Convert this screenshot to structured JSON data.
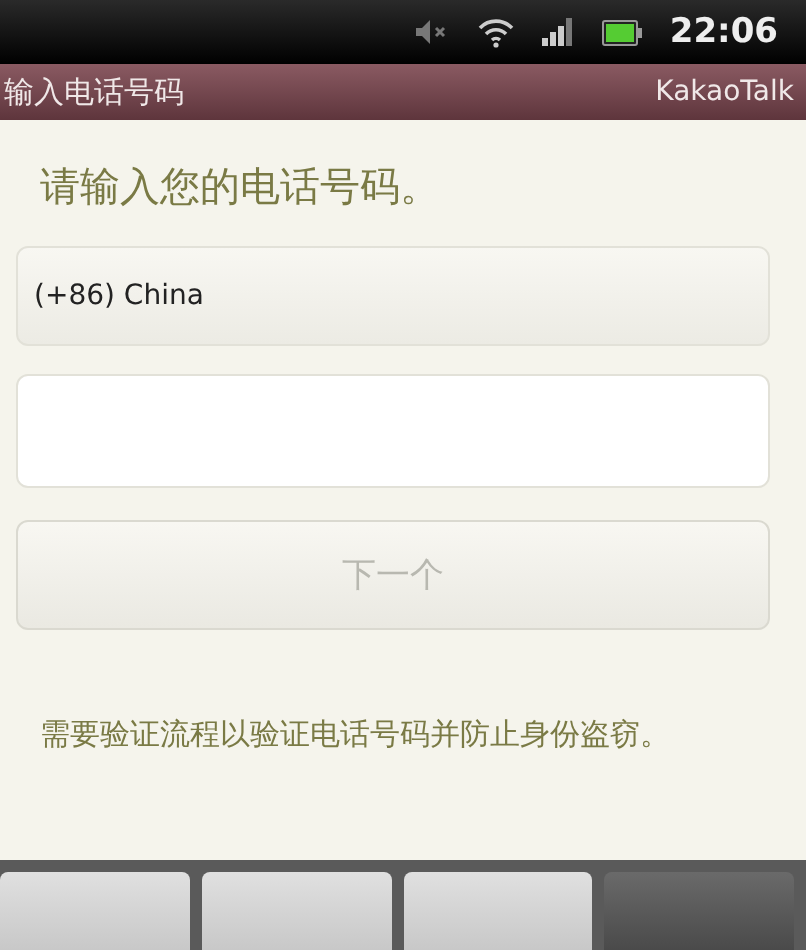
{
  "status_bar": {
    "time": "22:06"
  },
  "title_bar": {
    "title": "输入电话号码",
    "app_name": "KakaoTalk"
  },
  "heading": "请输入您的电话号码。",
  "country_field": {
    "value": "(+86) China"
  },
  "next_button": {
    "label": "下一个",
    "disabled": true
  },
  "note": "需要验证流程以验证电话号码并防止身份盗窃。"
}
